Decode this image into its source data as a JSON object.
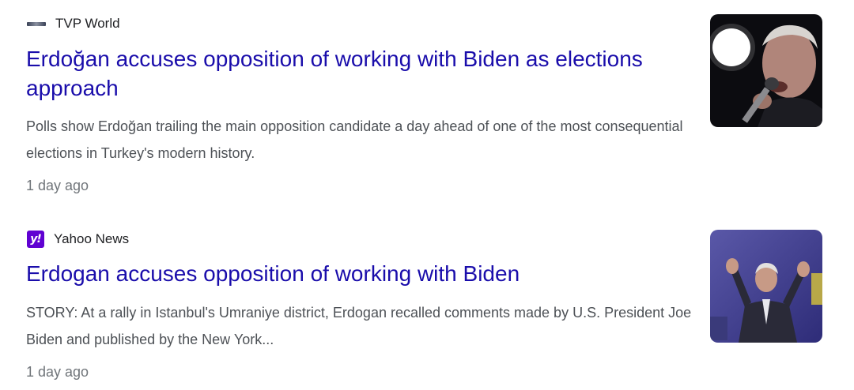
{
  "results": [
    {
      "source": {
        "name": "TVP World",
        "icon": "tvp-world-logo-icon"
      },
      "title": "Erdoğan accuses opposition of working with Biden as elections approach",
      "snippet": "Polls show Erdoğan trailing the main opposition candidate a day ahead of one of the most consequential elections in Turkey's modern history.",
      "time": "1 day ago",
      "thumbnail": "speaker-microphone-photo"
    },
    {
      "source": {
        "name": "Yahoo News",
        "icon": "yahoo-logo-icon",
        "icon_text": "y!"
      },
      "title": "Erdogan accuses opposition of working with Biden",
      "snippet": "STORY: At a rally in Istanbul's Umraniye district, Erdogan recalled comments made by U.S. President Joe Biden and published by the New York...",
      "time": "1 day ago",
      "thumbnail": "rally-waving-photo"
    }
  ],
  "colors": {
    "title_link": "#1a0dab",
    "snippet_text": "#4d5156",
    "time_text": "#70757a",
    "yahoo_brand": "#6001d2"
  }
}
